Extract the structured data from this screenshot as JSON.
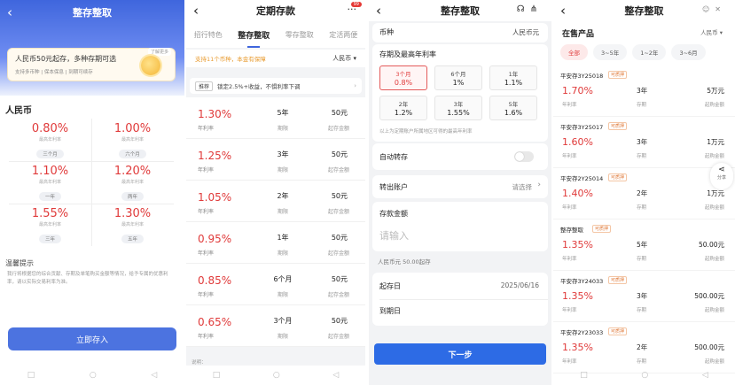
{
  "p1": {
    "title": "整存整取",
    "banner": {
      "title": "人民币50元起存，多种存期可选",
      "sub": "支持多币种 | 保本保息 | 到期可续存",
      "tag": "了解更多"
    },
    "currency": "人民币",
    "rates": [
      {
        "rate": "0.80%",
        "sub": "最高年利率",
        "term": "三个月"
      },
      {
        "rate": "1.00%",
        "sub": "最高年利率",
        "term": "六个月"
      },
      {
        "rate": "1.10%",
        "sub": "最高年利率",
        "term": "一年"
      },
      {
        "rate": "1.20%",
        "sub": "最高年利率",
        "term": "两年"
      },
      {
        "rate": "1.55%",
        "sub": "最高年利率",
        "term": "三年"
      },
      {
        "rate": "1.30%",
        "sub": "最高年利率",
        "term": "五年"
      }
    ],
    "tip_title": "温馨提示",
    "tip_text": "我行将根据您的综合贡献、存期及单笔购买金额等情况，给予专属的优惠利率，请以实际交易利率为准。",
    "button": "立即存入"
  },
  "p2": {
    "title": "定期存款",
    "badge": "99",
    "tabs": [
      "招行特色",
      "整存整取",
      "零存整取",
      "定活两便"
    ],
    "support": "支持11个币种，本金有保障",
    "currency": "人民币",
    "promo_label": "推荐",
    "promo_text": "锁定2.5%+收益，不惧利率下调",
    "rate_label": "年利率",
    "term_label": "期限",
    "amount_label": "起存金额",
    "products": [
      {
        "rate": "1.30%",
        "term": "5年",
        "amount": "50元"
      },
      {
        "rate": "1.25%",
        "term": "3年",
        "amount": "50元"
      },
      {
        "rate": "1.05%",
        "term": "2年",
        "amount": "50元"
      },
      {
        "rate": "0.95%",
        "term": "1年",
        "amount": "50元"
      },
      {
        "rate": "0.85%",
        "term": "6个月",
        "amount": "50元"
      },
      {
        "rate": "0.65%",
        "term": "3个月",
        "amount": "50元"
      }
    ],
    "note": "说明："
  },
  "p3": {
    "title": "整存整取",
    "currency_label": "币种",
    "currency_value": "人民币元",
    "terms_title": "存期及最高年利率",
    "tiles": [
      {
        "t": "3个月",
        "v": "0.8%"
      },
      {
        "t": "6个月",
        "v": "1%"
      },
      {
        "t": "1年",
        "v": "1.1%"
      },
      {
        "t": "2年",
        "v": "1.2%"
      },
      {
        "t": "3年",
        "v": "1.55%"
      },
      {
        "t": "5年",
        "v": "1.6%"
      }
    ],
    "note": "以上为定期账户所属地区可得的最高年利率",
    "auto_label": "自动转存",
    "account_label": "转出账户",
    "account_value": "请选择",
    "amount_label": "存款金额",
    "amount_placeholder": "请输入",
    "min_note": "人民币元 50.00起存",
    "start_label": "起存日",
    "start_value": "2025/06/16",
    "end_label": "到期日",
    "button": "下一步"
  },
  "p4": {
    "title": "整存整取",
    "section": "在售产品",
    "currency": "人民币",
    "filters": [
      "全部",
      "3~5年",
      "1~2年",
      "3~6月"
    ],
    "share_label": "分享",
    "products": [
      {
        "name": "平安存3Y25018",
        "tag": "可质押",
        "rate": "1.70%",
        "rate_label": "年利率",
        "term": "3年",
        "term_label": "存期",
        "amount": "5万元",
        "amount_label": "起购金额"
      },
      {
        "name": "平安存3Y25017",
        "tag": "可质押",
        "rate": "1.60%",
        "rate_label": "年利率",
        "term": "3年",
        "term_label": "存期",
        "amount": "1万元",
        "amount_label": "起购金额"
      },
      {
        "name": "平安存2Y25014",
        "tag": "可质押",
        "rate": "1.40%",
        "rate_label": "年利率",
        "term": "2年",
        "term_label": "存期",
        "amount": "1万元",
        "amount_label": "起购金额"
      },
      {
        "name": "整存整取",
        "tag": "可质押",
        "rate": "1.35%",
        "rate_label": "年利率",
        "term": "5年",
        "term_label": "存期",
        "amount": "50.00元",
        "amount_label": "起购金额"
      },
      {
        "name": "平安存3Y24033",
        "tag": "可质押",
        "rate": "1.35%",
        "rate_label": "年利率",
        "term": "3年",
        "term_label": "存期",
        "amount": "500.00元",
        "amount_label": "起购金额"
      },
      {
        "name": "平安存2Y23033",
        "tag": "可质押",
        "rate": "1.35%",
        "rate_label": "年利率",
        "term": "2年",
        "term_label": "存期",
        "amount": "500.00元",
        "amount_label": "起购金额"
      }
    ]
  },
  "colors": {
    "brand_blue": "#3f66dd",
    "rate_red": "#e03a3a",
    "accent_orange": "#e89a2e"
  }
}
